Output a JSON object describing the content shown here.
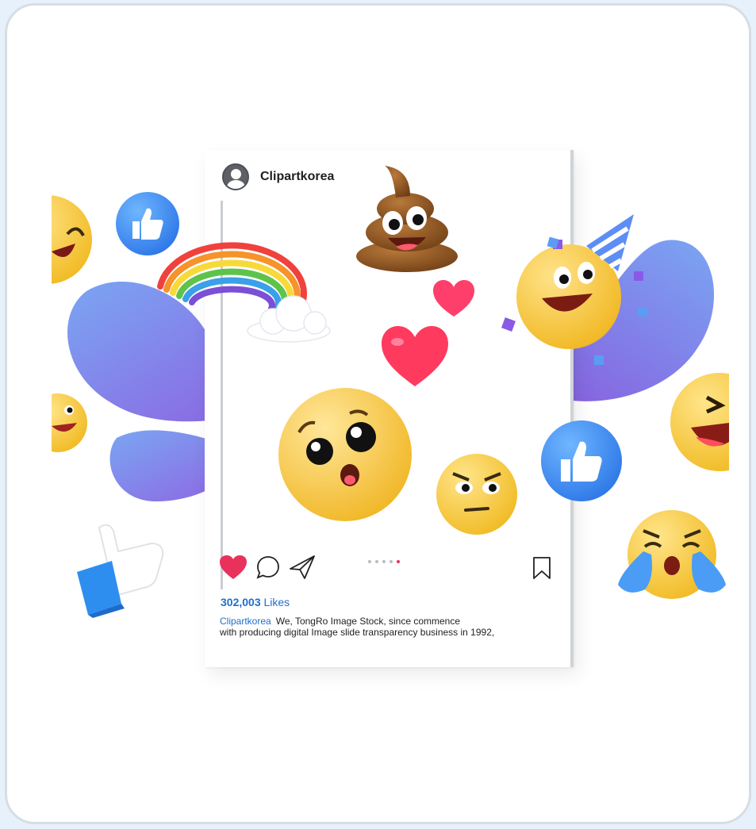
{
  "post": {
    "username": "Clipartkorea",
    "likes_count": "302,003",
    "likes_label": "Likes",
    "caption_user": "Clipartkorea",
    "caption_line1": "We, TongRo Image Stock, since commence",
    "caption_line2": "with producing digital Image slide transparency business in 1992,",
    "carousel": {
      "total": 5,
      "active": 5
    }
  },
  "colors": {
    "accent_blue": "#1e6fcb",
    "heart_red": "#e8325c",
    "background": "#e6f1fb"
  },
  "icons": {
    "like": "heart-icon",
    "comment": "comment-icon",
    "share": "paper-plane-icon",
    "save": "bookmark-icon"
  }
}
